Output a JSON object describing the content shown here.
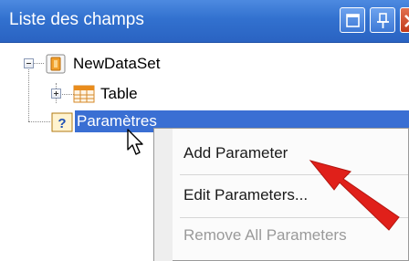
{
  "panel": {
    "title": "Liste des champs"
  },
  "tree": {
    "root_label": "NewDataSet",
    "table_label": "Table",
    "params_label": "Paramètres"
  },
  "context_menu": {
    "items": [
      {
        "label": "Add Parameter",
        "enabled": true
      },
      {
        "label": "Edit Parameters...",
        "enabled": true
      },
      {
        "label": "Remove All Parameters",
        "enabled": false
      }
    ]
  },
  "icons": {
    "window": "window-icon",
    "pin": "pin-icon",
    "close": "close-icon",
    "dataset": "dataset-icon",
    "table": "table-icon",
    "parameters": "question-icon",
    "cursor": "mouse-pointer-icon",
    "annotation": "red-arrow-icon"
  },
  "colors": {
    "titlebar": "#3271cf",
    "selection": "#3a6fd3",
    "arrow": "#e0201a"
  }
}
